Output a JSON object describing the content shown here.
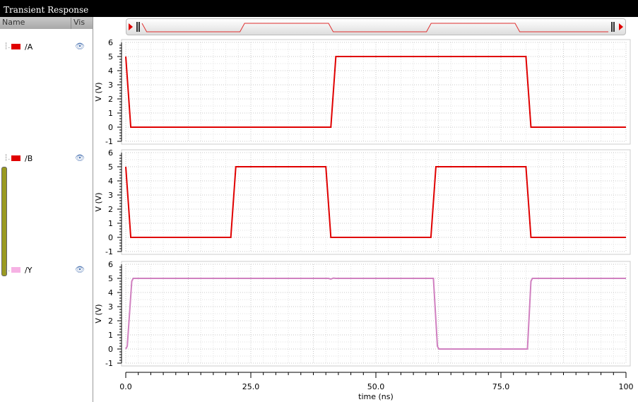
{
  "window": {
    "title": "Transient Response"
  },
  "sidebar": {
    "col_name": "Name",
    "col_vis": "Vis",
    "signals": [
      {
        "name": "/A",
        "color": "#e00000"
      },
      {
        "name": "/B",
        "color": "#e00000"
      },
      {
        "name": "/Y",
        "color": "#f6b2e4"
      }
    ]
  },
  "icons": {
    "tree": "tree-branch-icon",
    "eye": "eye-icon"
  },
  "chart_data": {
    "type": "line",
    "xlabel": "time (ns)",
    "ylabel": "V (V)",
    "xlim": [
      0,
      100
    ],
    "ylim": [
      -1,
      6
    ],
    "xticks": [
      "0.0",
      "25.0",
      "50.0",
      "75.0",
      "100"
    ],
    "yticks": [
      "-1",
      "0",
      "1",
      "2",
      "3",
      "4",
      "5",
      "6"
    ],
    "grid": true,
    "series": [
      {
        "name": "/A",
        "color": "#e00000",
        "x": [
          0,
          1,
          41,
          42,
          80,
          81,
          100
        ],
        "y": [
          5,
          0,
          0,
          5,
          5,
          0,
          0
        ]
      },
      {
        "name": "/B",
        "color": "#e00000",
        "x": [
          0,
          1,
          21,
          22,
          40,
          41,
          61,
          62,
          80,
          81,
          100
        ],
        "y": [
          5,
          0,
          0,
          5,
          5,
          0,
          0,
          5,
          5,
          0,
          0
        ]
      },
      {
        "name": "/Y",
        "color": "#d080c0",
        "x": [
          0,
          0.3,
          1.2,
          1.5,
          40.5,
          41,
          41.5,
          42,
          61.5,
          62.3,
          62.6,
          80.3,
          81,
          81.3,
          100
        ],
        "y": [
          0,
          0.2,
          4.8,
          5,
          5,
          4.95,
          5.02,
          5,
          5,
          0.2,
          0,
          0,
          4.8,
          5,
          5
        ]
      }
    ]
  }
}
